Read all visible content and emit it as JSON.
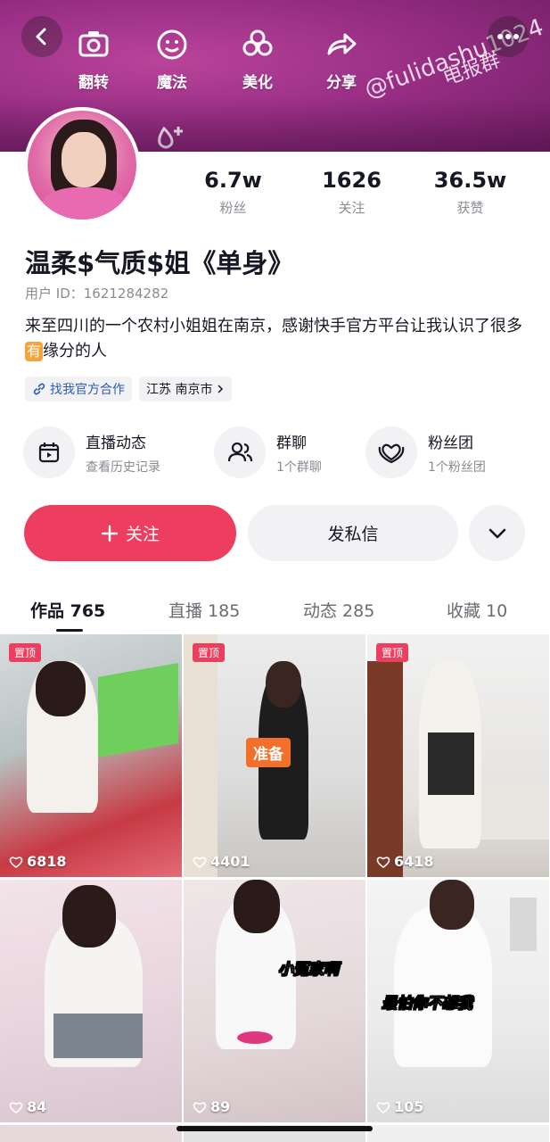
{
  "header": {
    "tools": [
      "翻转",
      "魔法",
      "美化",
      "分享",
      "分享"
    ],
    "watermark_handle": "@fulidashu1024",
    "watermark_group": "电报群"
  },
  "profile": {
    "stats": [
      {
        "value": "6.7w",
        "label": "粉丝"
      },
      {
        "value": "1626",
        "label": "关注"
      },
      {
        "value": "36.5w",
        "label": "获赞"
      }
    ],
    "name": "温柔$气质$姐《单身》",
    "user_id": "用户 ID：1621284282",
    "bio_before": "来至四川的一个农村小姐姐在南京，感谢快手官方平台让我认识了很多",
    "bio_badge": "有",
    "bio_after": "缘分的人",
    "tags": {
      "official": "找我官方合作",
      "location": "江苏 南京市"
    }
  },
  "features": [
    {
      "title": "直播动态",
      "subtitle": "查看历史记录",
      "icon": "calendar-play-icon"
    },
    {
      "title": "群聊",
      "subtitle": "1个群聊",
      "icon": "group-icon"
    },
    {
      "title": "粉丝团",
      "subtitle": "1个粉丝团",
      "icon": "heart-ring-icon"
    }
  ],
  "actions": {
    "follow": "关注",
    "message": "发私信"
  },
  "tabs": [
    {
      "label": "作品 765",
      "active": true
    },
    {
      "label": "直播 185",
      "active": false
    },
    {
      "label": "动态 285",
      "active": false
    },
    {
      "label": "收藏 10",
      "active": false
    }
  ],
  "videos": [
    {
      "pinned": "置顶",
      "likes": "6818",
      "caption": ""
    },
    {
      "pinned": "置顶",
      "likes": "4401",
      "caption": "准备"
    },
    {
      "pinned": "置顶",
      "likes": "6418",
      "caption": ""
    },
    {
      "pinned": "",
      "likes": "84",
      "caption": ""
    },
    {
      "pinned": "",
      "likes": "89",
      "caption": "小冤家啊"
    },
    {
      "pinned": "",
      "likes": "105",
      "caption": "最怕你不想我"
    }
  ],
  "colors": {
    "accent": "#ee3e5f",
    "muted": "#8a8b91",
    "surface": "#f2f2f4"
  }
}
